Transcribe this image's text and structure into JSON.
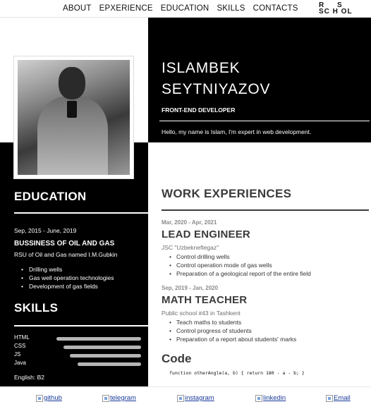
{
  "nav": {
    "items": [
      "ABOUT",
      "EPXERIENCE",
      "EDUCATION",
      "SKILLS",
      "CONTACTS"
    ],
    "logo_line1": "R S",
    "logo_line2": "SC H OL"
  },
  "header": {
    "first_name": "ISLAMBEK",
    "last_name": "SEYTNIYAZOV",
    "role": "FRONT-END DEVELOPER",
    "intro": "Hello, my name is Islam, I'm expert in web development."
  },
  "education": {
    "title": "EDUCATION",
    "date": "Sep, 2015 - June, 2019",
    "degree": "BUSSINESS OF OIL AND GAS",
    "school": "RSU of Oil and Gas named I.M.Gubkin",
    "items": [
      "Drilling wells",
      "Gas well operation technologies",
      "Development of gas fields"
    ]
  },
  "skills": {
    "title": "SKILLS",
    "items": [
      {
        "name": "HTML",
        "level": 0.75
      },
      {
        "name": "CSS",
        "level": 0.69
      },
      {
        "name": "JS",
        "level": 0.63
      },
      {
        "name": "Java",
        "level": 0.56
      }
    ],
    "english": "English: B2"
  },
  "work": {
    "title": "WORK EXPERIENCES",
    "jobs": [
      {
        "date": "Mar, 2020 - Apr, 2021",
        "title": "LEAD ENGINEER",
        "company": "JSC \"Uzbekneftegaz\"",
        "duties": [
          "Control drilling wells",
          "Control operation mode of gas wells",
          "Preparation of a geological report of the entire field"
        ]
      },
      {
        "date": "Sep, 2019 - Jan, 2020",
        "title": "MATH TEACHER",
        "company": "Public school #43 in Tashkent",
        "duties": [
          "Teach maths to students",
          "Control progress of students",
          "Preparation of a report about students' marks"
        ]
      }
    ]
  },
  "code": {
    "title": "Code",
    "snippet": "function otherAngle(a, b) { return 180 - a - b; }"
  },
  "footer": {
    "links": [
      "github",
      "telegram",
      "instagram",
      "linkedin",
      "Email"
    ]
  }
}
